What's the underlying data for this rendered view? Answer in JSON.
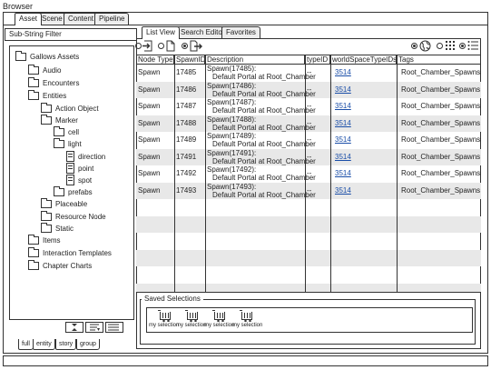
{
  "window": {
    "title": "Browser"
  },
  "top_tabs": [
    "Asset",
    "Scene",
    "Content",
    "Pipeline"
  ],
  "filter": {
    "placeholder": "Sub-String Filter"
  },
  "tree": {
    "items": [
      {
        "label": "Gallows Assets",
        "icon": "folder-icon"
      },
      {
        "label": "Audio",
        "icon": "folder-icon"
      },
      {
        "label": "Encounters",
        "icon": "folder-icon"
      },
      {
        "label": "Entities",
        "icon": "folder-icon"
      },
      {
        "label": "Action Object",
        "icon": "folder-icon"
      },
      {
        "label": "Marker",
        "icon": "folder-icon"
      },
      {
        "label": "cell",
        "icon": "folder-icon"
      },
      {
        "label": "light",
        "icon": "folder-icon"
      },
      {
        "label": "direction",
        "icon": "document-icon"
      },
      {
        "label": "point",
        "icon": "document-icon"
      },
      {
        "label": "spot",
        "icon": "document-icon"
      },
      {
        "label": "prefabs",
        "icon": "folder-icon"
      },
      {
        "label": "Placeable",
        "icon": "folder-icon"
      },
      {
        "label": "Resource Node",
        "icon": "folder-icon"
      },
      {
        "label": "Static",
        "icon": "folder-icon"
      },
      {
        "label": "Items",
        "icon": "folder-icon"
      },
      {
        "label": "Interaction Templates",
        "icon": "folder-icon"
      },
      {
        "label": "Chapter Charts",
        "icon": "folder-icon"
      }
    ]
  },
  "tree_buttons": [
    "collapse-icon",
    "filter-icon",
    "list-icon"
  ],
  "bottom_tabs": [
    "full",
    "entity",
    "story",
    "group"
  ],
  "right_tabs": [
    "List View",
    "Search Editor",
    "Favorites"
  ],
  "toolbar_icons": [
    "import-icon",
    "new-file-icon",
    "export-icon",
    "globe-icon",
    "grid-view-icon",
    "list-view-icon"
  ],
  "table": {
    "headers": [
      "Node Type",
      "SpawnID",
      "Description",
      "typeID",
      "worldSpaceTypeIDs",
      "Tags"
    ],
    "rows": [
      {
        "node_type": "Spawn",
        "spawn_id": "17485",
        "desc1": "Spawn(17485):",
        "desc2": "Default Portal at Root_Chamber",
        "type_id": "--",
        "ws": "3514",
        "tags": "Root_Chamber_Spawns"
      },
      {
        "node_type": "Spawn",
        "spawn_id": "17486",
        "desc1": "Spawn(17486):",
        "desc2": "Default Portal at Root_Chamber",
        "type_id": "--",
        "ws": "3514",
        "tags": "Root_Chamber_Spawns"
      },
      {
        "node_type": "Spawn",
        "spawn_id": "17487",
        "desc1": "Spawn(17487):",
        "desc2": "Default Portal at Root_Chamber",
        "type_id": "--",
        "ws": "3514",
        "tags": "Root_Chamber_Spawns"
      },
      {
        "node_type": "Spawn",
        "spawn_id": "17488",
        "desc1": "Spawn(17488):",
        "desc2": "Default Portal at Root_Chamber",
        "type_id": "--",
        "ws": "3514",
        "tags": "Root_Chamber_Spawns"
      },
      {
        "node_type": "Spawn",
        "spawn_id": "17489",
        "desc1": "Spawn(17489):",
        "desc2": "Default Portal at Root_Chamber",
        "type_id": "--",
        "ws": "3514",
        "tags": "Root_Chamber_Spawns"
      },
      {
        "node_type": "Spawn",
        "spawn_id": "17491",
        "desc1": "Spawn(17491):",
        "desc2": "Default Portal at Root_Chamber",
        "type_id": "--",
        "ws": "3514",
        "tags": "Root_Chamber_Spawns"
      },
      {
        "node_type": "Spawn",
        "spawn_id": "17492",
        "desc1": "Spawn(17492):",
        "desc2": "Default Portal at Root_Chamber",
        "type_id": "--",
        "ws": "3514",
        "tags": "Root_Chamber_Spawns"
      },
      {
        "node_type": "Spawn",
        "spawn_id": "17493",
        "desc1": "Spawn(17493):",
        "desc2": "Default Portal at Root_Chamber",
        "type_id": "--",
        "ws": "3514",
        "tags": "Root_Chamber_Spawns"
      }
    ]
  },
  "saved_selections": {
    "title": "Saved Selections",
    "items": [
      "my selection",
      "my selection",
      "my selection",
      "my selection"
    ]
  },
  "colors": {
    "link": "#1a4ea8",
    "row_alt": "#e8e8e8",
    "line": "#333333"
  }
}
